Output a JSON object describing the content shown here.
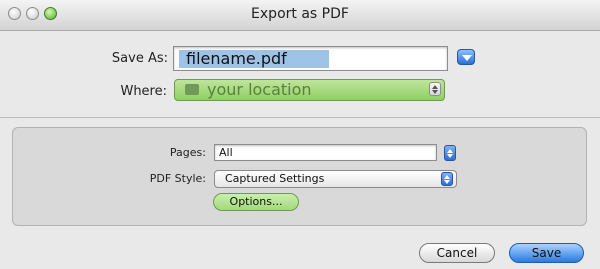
{
  "window": {
    "title": "Export as PDF"
  },
  "titlebar": {
    "buttons": [
      "close",
      "minimize",
      "zoom"
    ]
  },
  "save": {
    "label": "Save As:",
    "filename": "filename.pdf"
  },
  "where": {
    "label": "Where:",
    "value": "your location"
  },
  "options": {
    "pages": {
      "label": "Pages:",
      "value": "All"
    },
    "pdf_style": {
      "label": "PDF Style:",
      "value": "Captured Settings"
    },
    "options_button": "Options..."
  },
  "buttons": {
    "cancel": "Cancel",
    "save": "Save"
  },
  "colors": {
    "green_highlight": "#a9da80",
    "blue_highlight": "#9fc3e6",
    "primary": "#2c7ae0"
  }
}
